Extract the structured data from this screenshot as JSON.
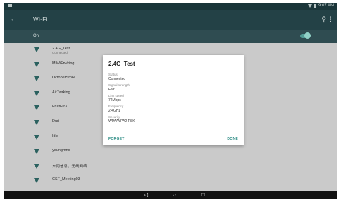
{
  "status_bar": {
    "time": "9:07 AM"
  },
  "app_bar": {
    "title": "Wi-Fi"
  },
  "wifi_switch": {
    "label": "On",
    "state": "on"
  },
  "networks": [
    {
      "name": "2.4G_Test",
      "status": "Connected"
    },
    {
      "name": "MiWiFrwking",
      "status": ""
    },
    {
      "name": "OctoberSmHI",
      "status": ""
    },
    {
      "name": "AirTwrking",
      "status": ""
    },
    {
      "name": "FruitFrr3",
      "status": ""
    },
    {
      "name": "Duri",
      "status": ""
    },
    {
      "name": "Idle",
      "status": ""
    },
    {
      "name": "youngmno",
      "status": ""
    },
    {
      "name": "东南信息，无线网络",
      "status": ""
    },
    {
      "name": "CSF_Meeting03",
      "status": ""
    }
  ],
  "dialog": {
    "title": "2.4G_Test",
    "fields": [
      {
        "label": "Status",
        "value": "Connected"
      },
      {
        "label": "Signal strength",
        "value": "Fair"
      },
      {
        "label": "Link speed",
        "value": "72Mbps"
      },
      {
        "label": "Frequency",
        "value": "2.4GHz"
      },
      {
        "label": "Security",
        "value": "WPA/WPA2 PSK"
      }
    ],
    "forget_label": "FORGET",
    "done_label": "DONE"
  },
  "nav": {
    "back": "◁",
    "home": "○",
    "recent": "□"
  },
  "colors": {
    "appbar": "#26474c",
    "accent": "#2c8c84",
    "toggle": "#5aa9a2"
  }
}
